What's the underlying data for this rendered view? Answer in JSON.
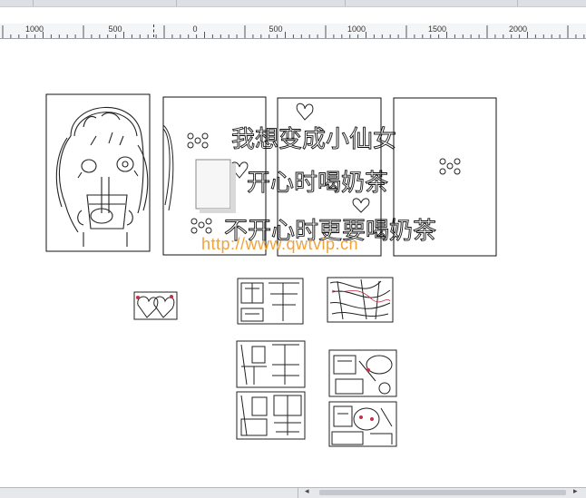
{
  "ruler": {
    "labels": [
      "1000",
      "500",
      "0",
      "500",
      "1000",
      "1500",
      "2000"
    ]
  },
  "canvas": {
    "text_row_1": "我想变成小仙女",
    "text_row_2": "开心时喝奶茶",
    "text_row_3": "不开心时更要喝奶茶",
    "watermark": "http://www.qwtvip.cn"
  },
  "colors": {
    "accent_red": "#c0304a",
    "watermark": "#f2a23a"
  }
}
